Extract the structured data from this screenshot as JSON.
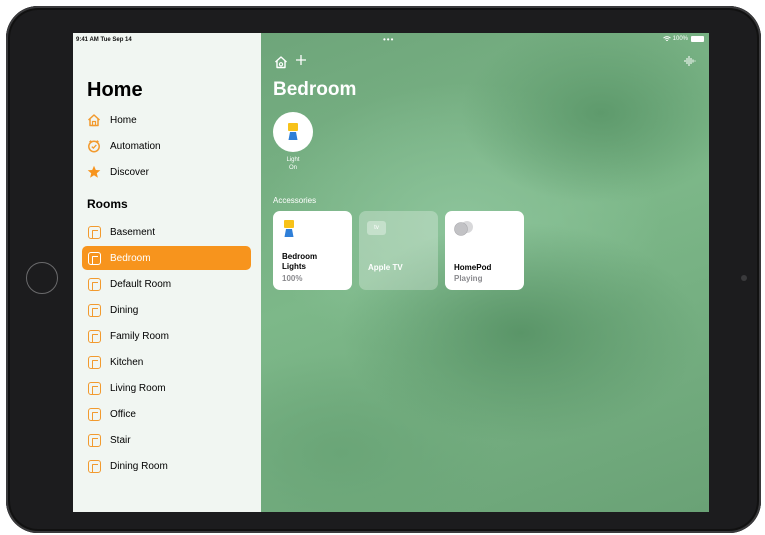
{
  "status_bar": {
    "time": "9:41 AM",
    "date": "Tue Sep 14",
    "battery": "100%"
  },
  "sidebar": {
    "title": "Home",
    "nav": [
      {
        "label": "Home",
        "icon": "house-icon"
      },
      {
        "label": "Automation",
        "icon": "clock-check-icon"
      },
      {
        "label": "Discover",
        "icon": "star-icon"
      }
    ],
    "rooms_header": "Rooms",
    "rooms": [
      {
        "label": "Basement"
      },
      {
        "label": "Bedroom",
        "selected": true
      },
      {
        "label": "Default Room"
      },
      {
        "label": "Dining"
      },
      {
        "label": "Family Room"
      },
      {
        "label": "Kitchen"
      },
      {
        "label": "Living Room"
      },
      {
        "label": "Office"
      },
      {
        "label": "Stair"
      },
      {
        "label": "Dining Room"
      }
    ]
  },
  "main": {
    "title": "Bedroom",
    "scene": {
      "line1": "Light",
      "line2": "On"
    },
    "accessories_label": "Accessories",
    "tiles": [
      {
        "name_line1": "Bedroom",
        "name_line2": "Lights",
        "status": "100%",
        "active": true
      },
      {
        "name_line1": "Apple TV",
        "name_line2": "",
        "status": "",
        "active": false,
        "badge": "tv"
      },
      {
        "name_line1": "HomePod",
        "name_line2": "",
        "status": "Playing",
        "active": true
      }
    ]
  },
  "colors": {
    "accent": "#f7941d",
    "sidebar_bg": "#f1f6f2",
    "main_bg": "#7fb18a"
  }
}
